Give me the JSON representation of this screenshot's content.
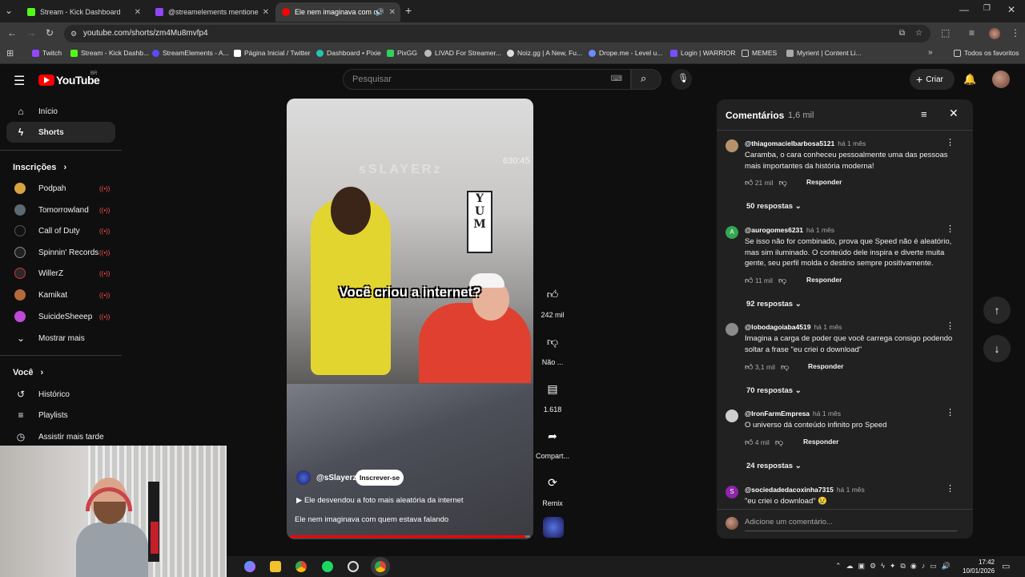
{
  "browser": {
    "tabs": [
      {
        "title": "Stream - Kick Dashboard",
        "color": "#53fc18"
      },
      {
        "title": "@streamelements mentione",
        "color": "#9146ff"
      },
      {
        "title": "Ele nem imaginava com qu",
        "color": "#ff0000"
      }
    ],
    "url": "youtube.com/shorts/zm4Mu8mvfp4",
    "bookmarks": [
      {
        "label": "Twitch",
        "color": "#9146ff"
      },
      {
        "label": "Stream - Kick Dashb...",
        "color": "#53fc18"
      },
      {
        "label": "StreamElements - A...",
        "color": "#5a4bff"
      },
      {
        "label": "Página Inicial / Twitter",
        "color": "#ffffff"
      },
      {
        "label": "Dashboard • Pixie",
        "color": "#27c4b0"
      },
      {
        "label": "PixGG",
        "color": "#30d158"
      },
      {
        "label": "LIVAD For Streamer...",
        "color": "#bbbbbb"
      },
      {
        "label": "Noiz.gg | A New, Fu...",
        "color": "#dddddd"
      },
      {
        "label": "Drope.me - Level u...",
        "color": "#6c8cff"
      },
      {
        "label": "Login | WARRIOR",
        "color": "#7a4dff"
      },
      {
        "label": "MEMES",
        "color": "#cccccc"
      },
      {
        "label": "Myrient | Content Li...",
        "color": "#aaaaaa"
      }
    ],
    "all_favorites": "Todos os favoritos"
  },
  "youtube": {
    "logo": "YouTube",
    "region": "BR",
    "search_placeholder": "Pesquisar",
    "create_label": "Criar"
  },
  "sidebar": {
    "main": [
      {
        "label": "Início",
        "icon": "home-icon"
      },
      {
        "label": "Shorts",
        "icon": "shorts-icon"
      }
    ],
    "subs_header": "Inscrições",
    "subscriptions": [
      {
        "label": "Podpah",
        "color": "#d8a440"
      },
      {
        "label": "Tomorrowland",
        "color": "#5a6a70"
      },
      {
        "label": "Call of Duty",
        "color": "#111111"
      },
      {
        "label": "Spinnin' Records",
        "color": "#222222"
      },
      {
        "label": "WillerZ",
        "color": "#2a2a2a"
      },
      {
        "label": "Kamikat",
        "color": "#b46a3a"
      },
      {
        "label": "SuicideSheeep",
        "color": "#c04ad8"
      }
    ],
    "show_more": "Mostrar mais",
    "you_header": "Você",
    "you_items": [
      {
        "label": "Histórico",
        "icon": "history-icon"
      },
      {
        "label": "Playlists",
        "icon": "playlists-icon"
      },
      {
        "label": "Assistir mais tarde",
        "icon": "watch-later-icon"
      }
    ]
  },
  "video": {
    "watermark": "sSLAYERz",
    "watermark_count": "630:45",
    "sign": "YUM",
    "caption": "Você criou a internet?",
    "channel": "@sSlayerz",
    "subscribe": "Inscrever-se",
    "linked_video": "Ele desvendou a foto mais aleatória da internet",
    "title": "Ele nem imaginava com quem estava falando",
    "progress": 0.98
  },
  "actions": {
    "likes": "242 mil",
    "dislike": "Não ...",
    "comments": "1.618",
    "share": "Compart...",
    "remix": "Remix"
  },
  "comments": {
    "title": "Comentários",
    "count": "1,6 mil",
    "reply_label": "Responder",
    "items": [
      {
        "user": "@thiagomacielbarbosa5121",
        "time": "há 1 mês",
        "text": "Caramba, o cara conheceu pessoalmente uma das pessoas mais importantes da história moderna!",
        "likes": "21 mil",
        "replies": "50 respostas",
        "avatar_color": "#b8926a",
        "avatar_letter": ""
      },
      {
        "user": "@aurogomes6231",
        "time": "há 1 mês",
        "text": "Se isso não for combinado, prova que Speed não é aleatório, mas sim iluminado. O conteúdo dele inspira e diverte muita gente, seu perfil molda o destino sempre positivamente.",
        "likes": "11 mil",
        "replies": "92 respostas",
        "avatar_color": "#33a852",
        "avatar_letter": "A"
      },
      {
        "user": "@lobodagoiaba4519",
        "time": "há 1 mês",
        "text": "Imagina a carga de poder que você carrega consigo podendo soltar a frase \"eu criei o download\"",
        "likes": "3,1 mil",
        "replies": "70 respostas",
        "avatar_color": "#8a8a8a",
        "avatar_letter": ""
      },
      {
        "user": "@IronFarmEmpresa",
        "time": "há 1 mês",
        "text": "O universo dá conteúdo infinito pro Speed",
        "likes": "4 mil",
        "replies": "24 respostas",
        "avatar_color": "#cfcfcf",
        "avatar_letter": ""
      },
      {
        "user": "@sociedadedacoxinha7315",
        "time": "há 1 mês",
        "text": "\"eu criei o download\" 😢",
        "likes": "",
        "replies": "",
        "avatar_color": "#8e24aa",
        "avatar_letter": "S"
      }
    ],
    "input_placeholder": "Adicione um comentário..."
  },
  "taskbar": {
    "time": "17:42",
    "date": "10/01/2026"
  }
}
